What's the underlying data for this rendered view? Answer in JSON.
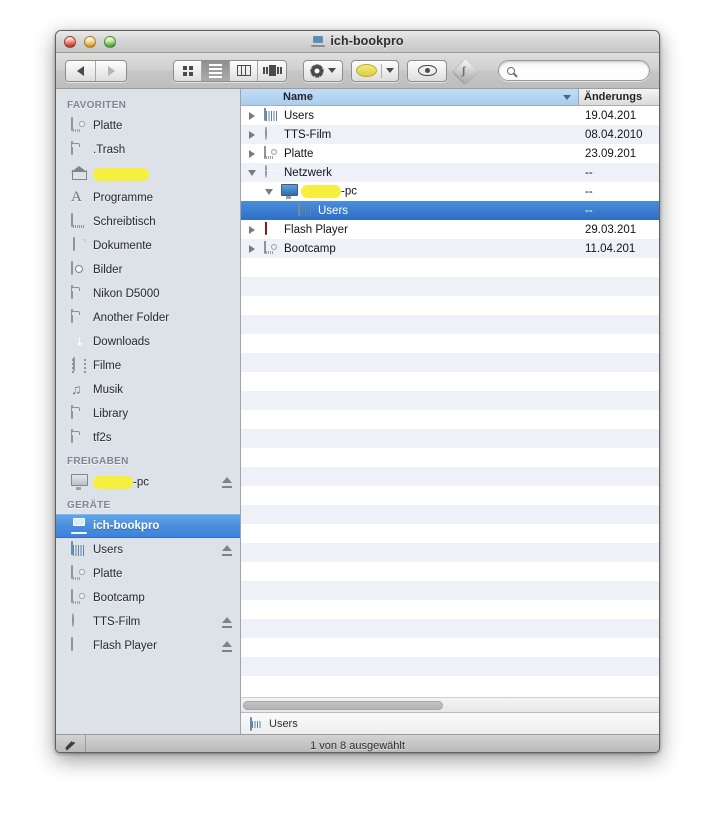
{
  "window": {
    "title": "ich-bookpro",
    "title_icon": "laptop-icon"
  },
  "toolbar": {
    "back_icon": "back-arrow-icon",
    "forward_icon": "forward-arrow-icon",
    "view_modes": [
      {
        "name": "icon-view",
        "active": false
      },
      {
        "name": "list-view",
        "active": true
      },
      {
        "name": "column-view",
        "active": false
      },
      {
        "name": "coverflow-view",
        "active": false
      }
    ],
    "action_icon": "gear-icon",
    "label_icon": "yellow-label-icon",
    "quicklook_icon": "eye-icon",
    "app_icon": "script-app-icon",
    "search": {
      "placeholder": "",
      "value": "",
      "icon": "search-icon",
      "clear_icon": "clear-icon",
      "clear_glyph": "×"
    }
  },
  "sidebar": {
    "sections": [
      {
        "header": "FAVORITEN",
        "items": [
          {
            "label": "Platte",
            "icon": "hard-disk-icon",
            "eject": false,
            "selected": false,
            "redacted": false
          },
          {
            "label": ".Trash",
            "icon": "folder-icon",
            "eject": false,
            "selected": false,
            "redacted": false
          },
          {
            "label": "",
            "icon": "home-icon",
            "eject": false,
            "selected": false,
            "redacted": true,
            "redact_width": 56
          },
          {
            "label": "Programme",
            "icon": "applications-icon",
            "eject": false,
            "selected": false,
            "redacted": false
          },
          {
            "label": "Schreibtisch",
            "icon": "desktop-icon",
            "eject": false,
            "selected": false,
            "redacted": false
          },
          {
            "label": "Dokumente",
            "icon": "documents-icon",
            "eject": false,
            "selected": false,
            "redacted": false
          },
          {
            "label": "Bilder",
            "icon": "pictures-icon",
            "eject": false,
            "selected": false,
            "redacted": false
          },
          {
            "label": "Nikon D5000",
            "icon": "folder-icon",
            "eject": false,
            "selected": false,
            "redacted": false
          },
          {
            "label": "Another Folder",
            "icon": "folder-icon",
            "eject": false,
            "selected": false,
            "redacted": false
          },
          {
            "label": "Downloads",
            "icon": "downloads-icon",
            "eject": false,
            "selected": false,
            "redacted": false
          },
          {
            "label": "Filme",
            "icon": "movies-icon",
            "eject": false,
            "selected": false,
            "redacted": false
          },
          {
            "label": "Musik",
            "icon": "music-icon",
            "eject": false,
            "selected": false,
            "redacted": false
          },
          {
            "label": "Library",
            "icon": "folder-icon",
            "eject": false,
            "selected": false,
            "redacted": false
          },
          {
            "label": "tf2s",
            "icon": "folder-icon",
            "eject": false,
            "selected": false,
            "redacted": false
          }
        ]
      },
      {
        "header": "FREIGABEN",
        "items": [
          {
            "label": "-pc",
            "icon": "monitor-icon",
            "eject": true,
            "selected": false,
            "redacted": true,
            "redact_width": 40
          }
        ]
      },
      {
        "header": "GERÄTE",
        "items": [
          {
            "label": "ich-bookpro",
            "icon": "laptop-icon",
            "eject": false,
            "selected": true,
            "redacted": false
          },
          {
            "label": "Users",
            "icon": "network-drive-icon",
            "eject": true,
            "selected": false,
            "redacted": false
          },
          {
            "label": "Platte",
            "icon": "hard-disk-icon",
            "eject": false,
            "selected": false,
            "redacted": false
          },
          {
            "label": "Bootcamp",
            "icon": "hard-disk-icon",
            "eject": false,
            "selected": false,
            "redacted": false
          },
          {
            "label": "TTS-Film",
            "icon": "cd-icon",
            "eject": true,
            "selected": false,
            "redacted": false
          },
          {
            "label": "Flash Player",
            "icon": "disk-image-icon",
            "eject": true,
            "selected": false,
            "redacted": false
          }
        ]
      }
    ]
  },
  "filelist": {
    "columns": [
      {
        "label": "Name",
        "sorted": true,
        "sort_direction": "descending"
      },
      {
        "label": "Änderungs",
        "sorted": false
      }
    ],
    "rows": [
      {
        "name": "Users",
        "date": "19.04.201",
        "icon": "network-drive-icon",
        "indent": 0,
        "disclosure": "closed",
        "selected": false,
        "redacted": false
      },
      {
        "name": "TTS-Film",
        "date": "08.04.2010",
        "icon": "cd-icon",
        "indent": 0,
        "disclosure": "closed",
        "selected": false,
        "redacted": false
      },
      {
        "name": "Platte",
        "date": "23.09.201",
        "icon": "hard-disk-icon",
        "indent": 0,
        "disclosure": "closed",
        "selected": false,
        "redacted": false
      },
      {
        "name": "Netzwerk",
        "date": "--",
        "icon": "globe-icon",
        "indent": 0,
        "disclosure": "open",
        "selected": false,
        "redacted": false
      },
      {
        "name": "-pc",
        "date": "--",
        "icon": "pc-monitor-icon",
        "indent": 1,
        "disclosure": "open",
        "selected": false,
        "redacted": true,
        "redact_width": 40
      },
      {
        "name": "Users",
        "date": "--",
        "icon": "network-folder-icon",
        "indent": 2,
        "disclosure": "none",
        "selected": true,
        "redacted": false
      },
      {
        "name": "Flash Player",
        "date": "29.03.201",
        "icon": "flash-icon",
        "indent": 0,
        "disclosure": "closed",
        "selected": false,
        "redacted": false
      },
      {
        "name": "Bootcamp",
        "date": "11.04.201",
        "icon": "hard-disk-icon",
        "indent": 0,
        "disclosure": "closed",
        "selected": false,
        "redacted": false
      }
    ],
    "empty_rows": 23
  },
  "pathbar": {
    "current": "Users",
    "icon": "network-folder-icon"
  },
  "statusbar": {
    "text": "1 von 8 ausgewählt",
    "pin_icon": "pin-icon"
  },
  "colors": {
    "selection_blue": "#3d82da",
    "sidebar_bg": "#dde2e9",
    "row_stripe": "#eef2f8",
    "redaction_yellow": "#f6ef3f",
    "sort_header_blue": "#a8cdf0"
  }
}
